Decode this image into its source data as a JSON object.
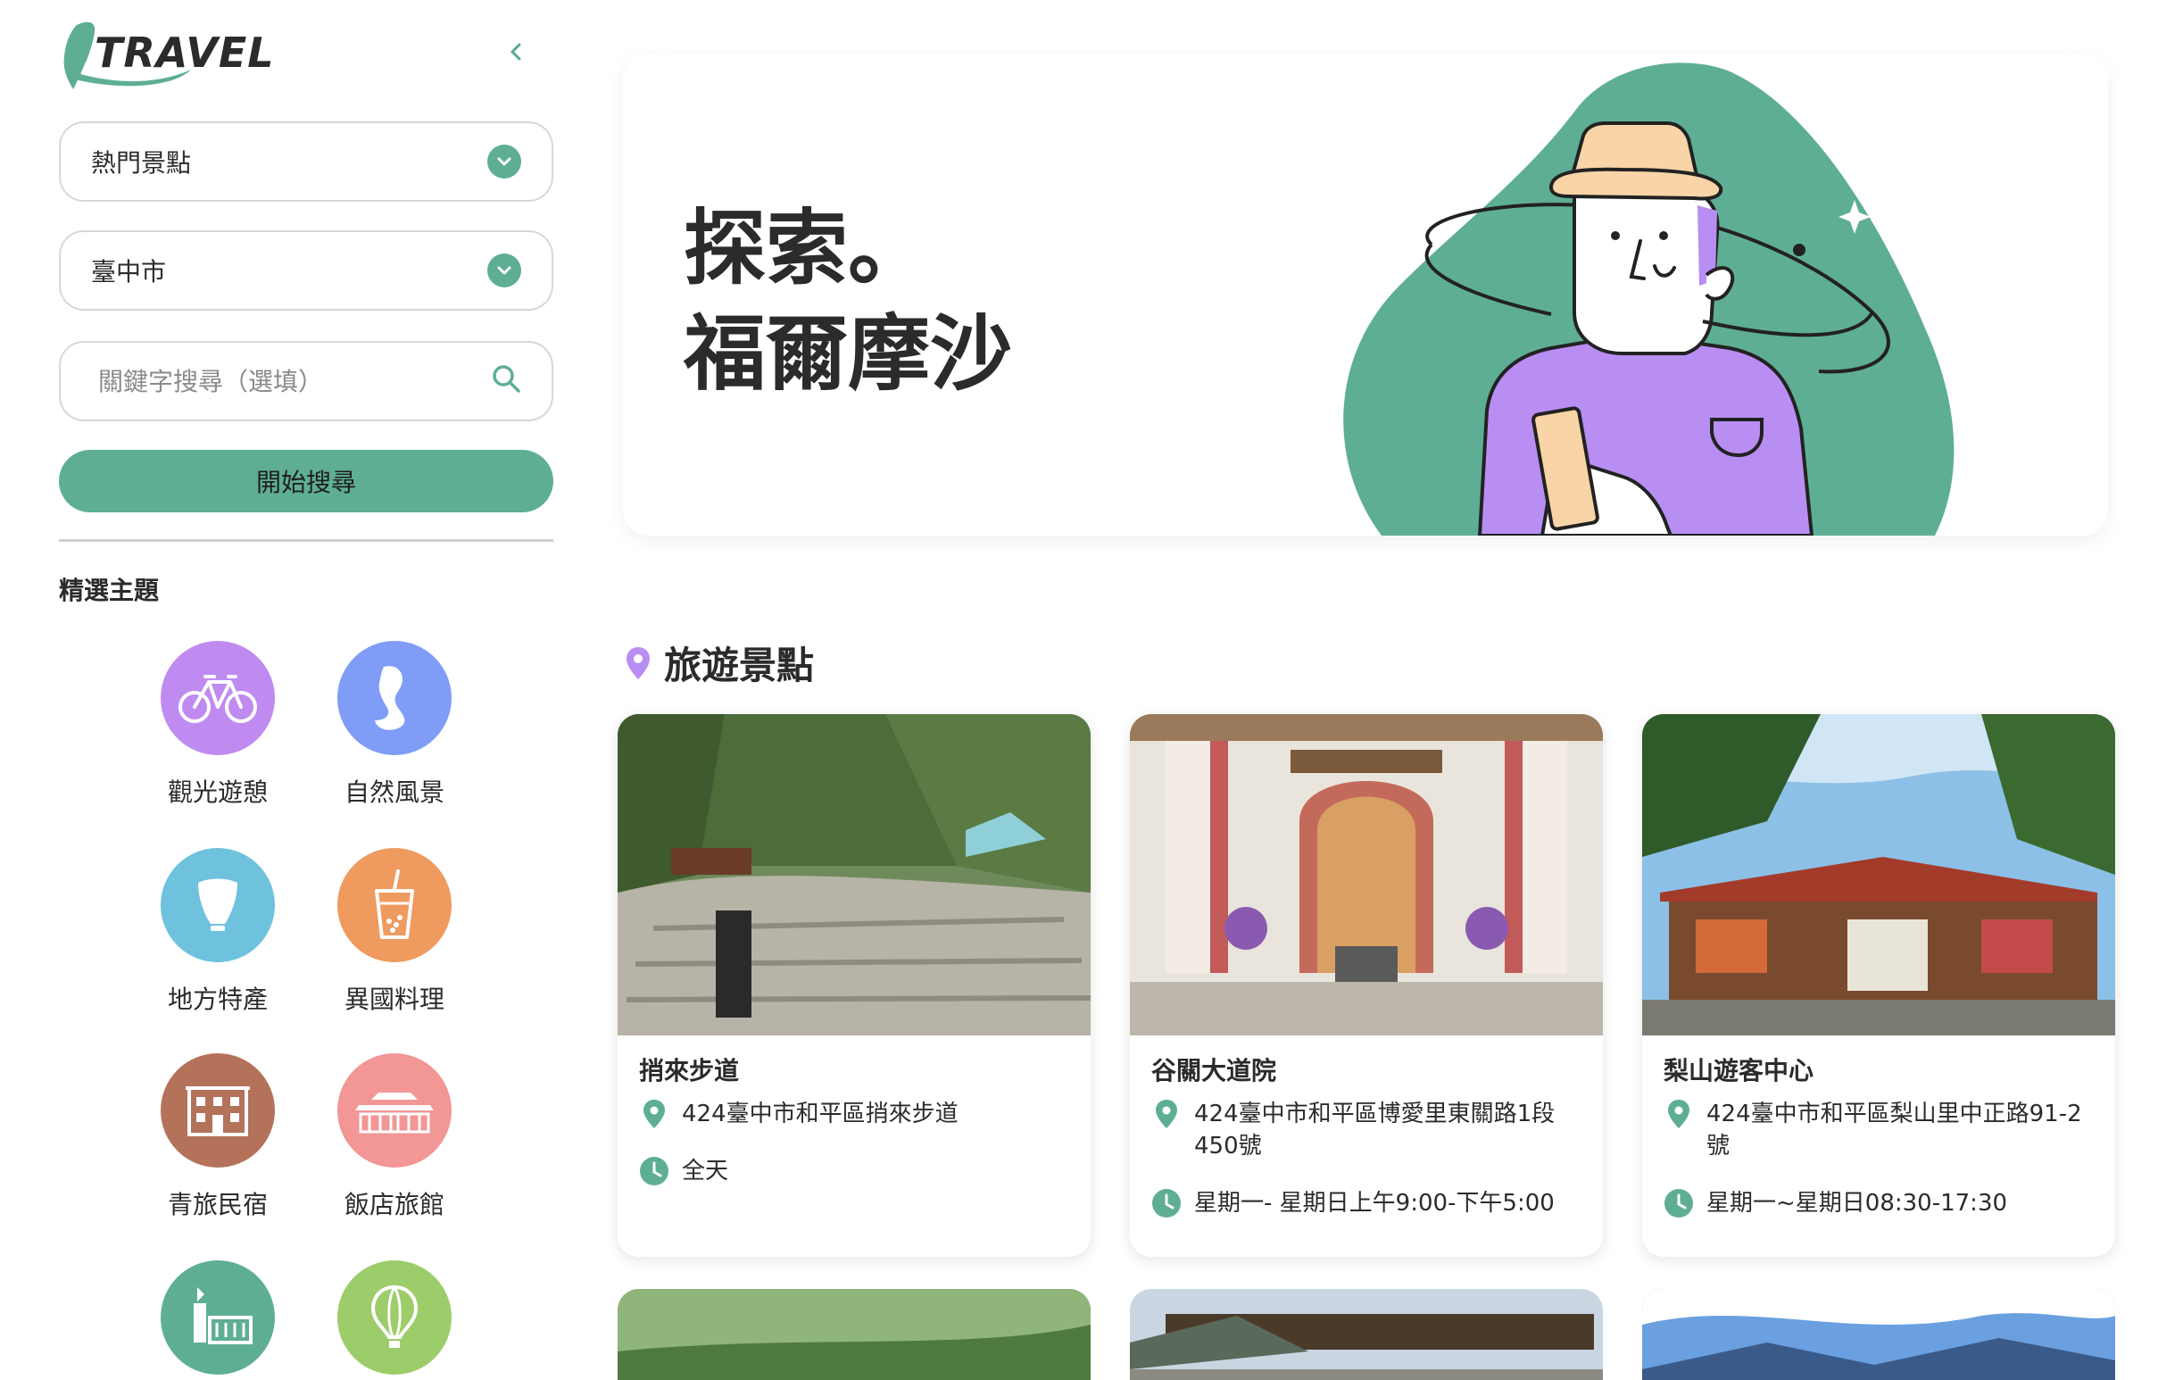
{
  "brand": {
    "logo_text": "TRAVEL"
  },
  "sidebar": {
    "category_select": "熱門景點",
    "city_select": "臺中市",
    "keyword_placeholder": "關鍵字搜尋（選填）",
    "search_button": "開始搜尋",
    "themes_title": "精選主題",
    "themes": [
      {
        "label": "觀光遊憩",
        "icon": "bicycle-icon",
        "color": "#c08bf0"
      },
      {
        "label": "自然風景",
        "icon": "landscape-icon",
        "color": "#7f9df7"
      },
      {
        "label": "地方特產",
        "icon": "lantern-icon",
        "color": "#6fc2de"
      },
      {
        "label": "異國料理",
        "icon": "bubble-tea-icon",
        "color": "#ef9a5f"
      },
      {
        "label": "青旅民宿",
        "icon": "hostel-building-icon",
        "color": "#b5725a"
      },
      {
        "label": "飯店旅館",
        "icon": "hotel-temple-icon",
        "color": "#f29696"
      },
      {
        "label": "",
        "icon": "lighthouse-icon",
        "color": "#5eae95"
      },
      {
        "label": "",
        "icon": "hot-air-balloon-icon",
        "color": "#9dcc6a"
      }
    ]
  },
  "hero": {
    "line1": "探索。",
    "line2": "福爾摩沙"
  },
  "attractions": {
    "heading": "旅遊景點",
    "cards": [
      {
        "title": "捎來步道",
        "address": "424臺中市和平區捎來步道",
        "hours": "全天"
      },
      {
        "title": "谷關大道院",
        "address": "424臺中市和平區博愛里東關路1段450號",
        "hours": "星期一- 星期日上午9:00-下午5:00"
      },
      {
        "title": "梨山遊客中心",
        "address": "424臺中市和平區梨山里中正路91-2號",
        "hours": "星期一~星期日08:30-17:30"
      }
    ]
  },
  "colors": {
    "accent": "#5eae95",
    "purple": "#b88ef3",
    "border": "#d8d8d8"
  }
}
